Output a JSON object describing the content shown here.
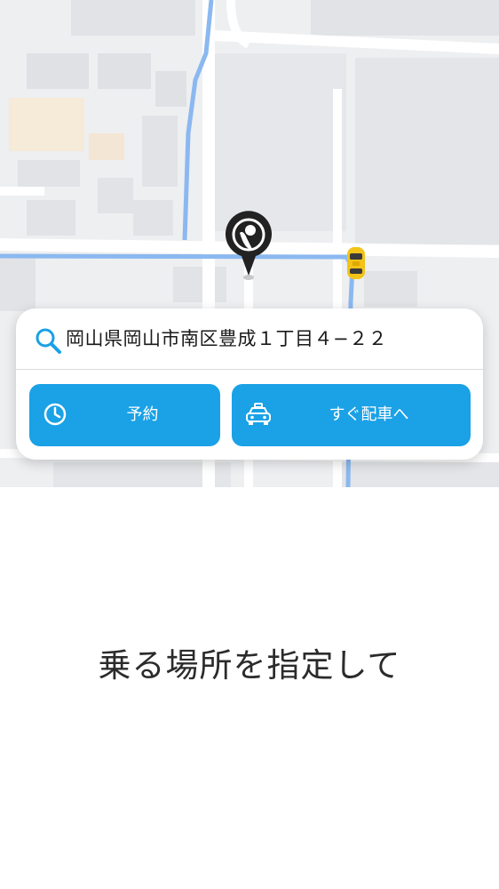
{
  "map": {
    "pin_icon": "location-pin-icon",
    "taxi_icon": "taxi-car-icon"
  },
  "search": {
    "address": "岡山県岡山市南区豊成１丁目４−２２",
    "icon": "search-icon"
  },
  "actions": {
    "reserve_label": "予約",
    "reserve_icon": "clock-icon",
    "dispatch_now_label": "すぐ配車へ",
    "dispatch_now_icon": "car-icon"
  },
  "prompt_text": "乗る場所を指定して",
  "colors": {
    "accent": "#1aa1e6",
    "road_blue": "#8bb8f0",
    "map_bg": "#eeeff1",
    "pin": "#222222",
    "taxi": "#f2c318"
  }
}
